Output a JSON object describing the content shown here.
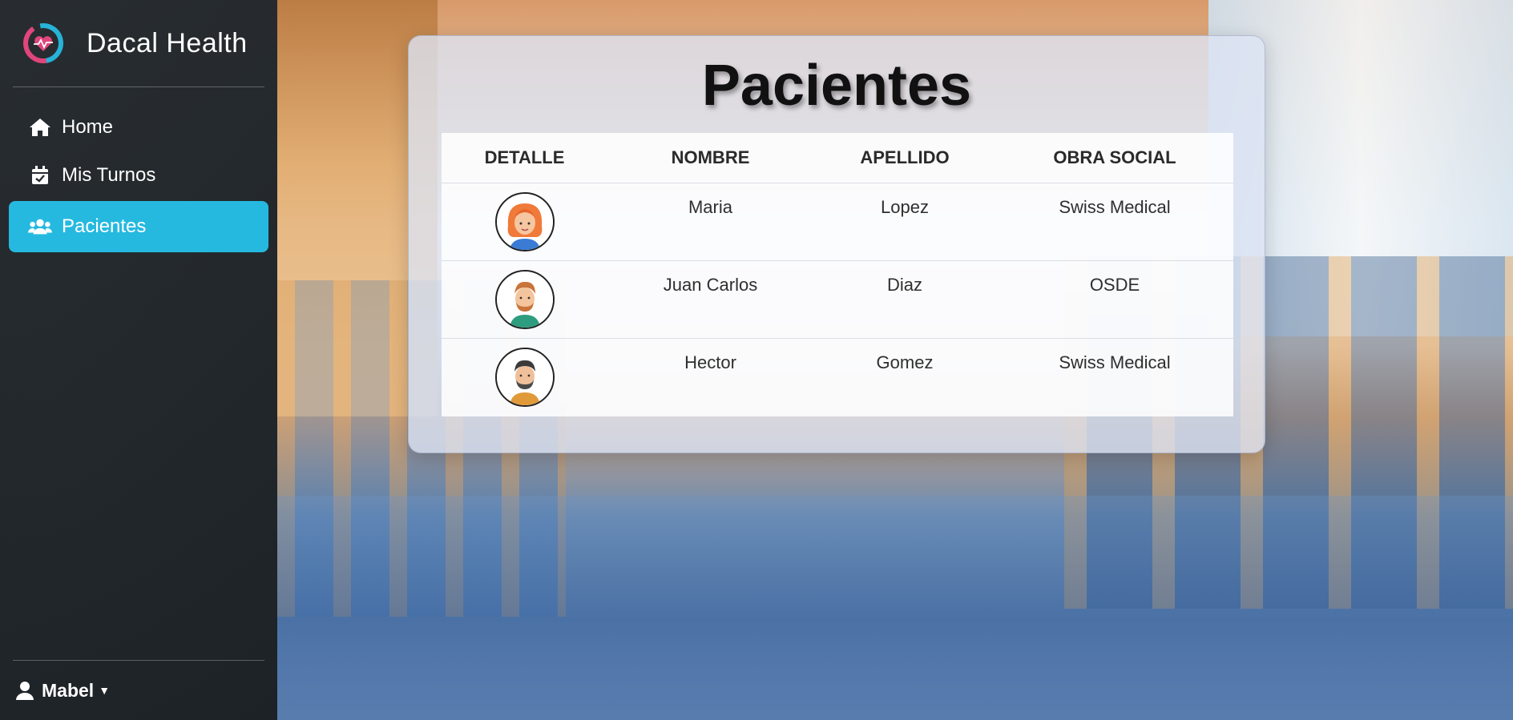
{
  "app": {
    "title": "Dacal Health"
  },
  "sidebar": {
    "items": [
      {
        "label": "Home",
        "icon": "home-icon",
        "active": false
      },
      {
        "label": "Mis Turnos",
        "icon": "calendar-check-icon",
        "active": false
      },
      {
        "label": "Pacientes",
        "icon": "users-icon",
        "active": true
      }
    ],
    "user": {
      "name": "Mabel",
      "icon": "user-icon"
    }
  },
  "main": {
    "title": "Pacientes",
    "table": {
      "columns": [
        "DETALLE",
        "NOMBRE",
        "APELLIDO",
        "OBRA SOCIAL"
      ],
      "rows": [
        {
          "avatar": "woman-red-hair-avatar",
          "nombre": "Maria",
          "apellido": "Lopez",
          "obra_social": "Swiss Medical"
        },
        {
          "avatar": "man-beard-avatar",
          "nombre": "Juan Carlos",
          "apellido": "Diaz",
          "obra_social": "OSDE"
        },
        {
          "avatar": "man-dark-beard-avatar",
          "nombre": "Hector",
          "apellido": "Gomez",
          "obra_social": "Swiss Medical"
        }
      ]
    }
  },
  "colors": {
    "accent": "#25b9e0",
    "sidebar_bg": "#262b30"
  }
}
